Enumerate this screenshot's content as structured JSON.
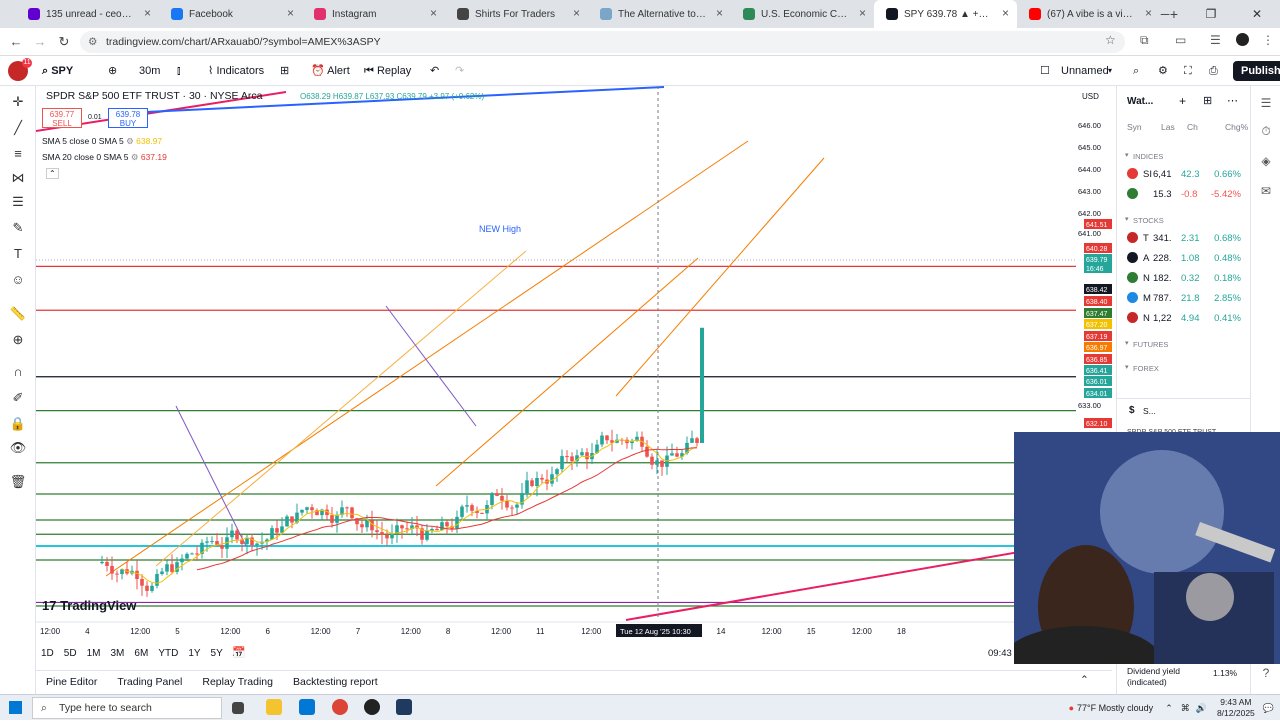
{
  "browser": {
    "tabs": [
      {
        "label": "135 unread - ceo4ams@y",
        "color": "#6001d2"
      },
      {
        "label": "Facebook",
        "color": "#1877f2"
      },
      {
        "label": "Instagram",
        "color": "#e1306c"
      },
      {
        "label": "Shirts For Traders",
        "color": "#444444"
      },
      {
        "label": "The Alternative to IVF - D",
        "color": "#7aa7c7"
      },
      {
        "label": "U.S. Economic Calendar -",
        "color": "#2e8b57"
      },
      {
        "label": "SPY 639.78 ▲ +0.61% Uni",
        "color": "#131722",
        "active": true
      },
      {
        "label": "(67) A vibe is a vibe r",
        "color": "#ff0000"
      }
    ],
    "url": "tradingview.com/chart/ARxauab0/?symbol=AMEX%3ASPY"
  },
  "toolbar": {
    "symbol": "SPY",
    "interval": "30m",
    "indicators": "Indicators",
    "alert": "Alert",
    "replay": "Replay",
    "layout": "Unnamed",
    "publish": "Publish"
  },
  "chart": {
    "title": "SPDR S&P 500 ETF TRUST · 30 · NYSE Arca",
    "ohlc": "O638.29 H639.87 L637.93 C639.79 +3.97 (+0.62%)",
    "sell_price": "639.77",
    "sell_label": "SELL",
    "spread": "0.01",
    "buy_price": "639.78",
    "buy_label": "BUY",
    "sma5_label": "SMA 5 close 0 SMA 5",
    "sma5_value": "638.97",
    "sma20_label": "SMA 20 close 0 SMA 5",
    "sma20_value": "637.19",
    "annotation": "NEW High",
    "currency": "USD",
    "price_ticks": [
      "646.00",
      "645.00",
      "644.00",
      "643.00",
      "642.00",
      "641.00",
      "633.00"
    ],
    "price_tags": [
      {
        "label": "641.51",
        "color": "#e53935"
      },
      {
        "label": "640.28",
        "color": "#e53935"
      },
      {
        "label": "639.79",
        "color": "#26a69a"
      },
      {
        "label": "16:46",
        "color": "#26a69a"
      },
      {
        "label": "638.42",
        "color": "#131722"
      },
      {
        "label": "638.40",
        "color": "#e53935"
      },
      {
        "label": "637.47",
        "color": "#2e7d32"
      },
      {
        "label": "637.20",
        "color": "#f2c200"
      },
      {
        "label": "637.19",
        "color": "#e53935"
      },
      {
        "label": "636.97",
        "color": "#f57c00"
      },
      {
        "label": "636.85",
        "color": "#e53935"
      },
      {
        "label": "636.41",
        "color": "#26a69a"
      },
      {
        "label": "636.01",
        "color": "#26a69a"
      },
      {
        "label": "634.01",
        "color": "#26a69a"
      },
      {
        "label": "632.10",
        "color": "#e53935"
      }
    ],
    "time_ticks": [
      "12:00",
      "4",
      "12:00",
      "5",
      "12:00",
      "6",
      "12:00",
      "7",
      "12:00",
      "8",
      "12:00",
      "11",
      "12:00",
      "13",
      "12:00",
      "14",
      "12:00",
      "15",
      "12:00",
      "18"
    ],
    "crosshair_time": "Tue 12 Aug '25   10:30",
    "clock": "09:43",
    "watermark": "TradingView",
    "ranges": [
      "1D",
      "5D",
      "1M",
      "3M",
      "6M",
      "YTD",
      "1Y",
      "5Y",
      "All"
    ],
    "colors": {
      "up": "#26a69a",
      "down": "#ef5350",
      "sma5": "#f2c200",
      "sma20": "#e53935",
      "channel": "#f57c00"
    }
  },
  "chart_data": {
    "type": "candlestick",
    "series": [
      {
        "name": "SMA 5 close 0 SMA 5"
      },
      {
        "name": "SMA 20 close 0 SMA 5"
      }
    ],
    "ylim": [
      632,
      646
    ],
    "horizontal_levels": [
      641.51,
      640.28,
      638.42,
      637.47,
      636.01,
      634.01,
      632.1
    ],
    "last_close": 639.79
  },
  "bottom_panels": [
    "Pine Editor",
    "Trading Panel",
    "Replay Trading",
    "Backtesting report"
  ],
  "watchlist": {
    "title": "Wat...",
    "cols": [
      "Syn",
      "Las",
      "Ch",
      "Chg%"
    ],
    "sections": [
      "INDICES",
      "STOCKS",
      "FUTURES",
      "FOREX"
    ],
    "indices": [
      {
        "sym": "SI",
        "last": "6,41",
        "chg": "42.3",
        "pct": "0.66%",
        "up": true,
        "color": "#e53935"
      },
      {
        "sym": "",
        "last": "15.3",
        "chg": "-0.8",
        "pct": "-5.42%",
        "up": false,
        "color": "#2e7d32"
      }
    ],
    "stocks": [
      {
        "sym": "T",
        "last": "341.",
        "chg": "2.31",
        "pct": "0.68%",
        "color": "#c62828"
      },
      {
        "sym": "A",
        "last": "228.",
        "chg": "1.08",
        "pct": "0.48%",
        "color": "#131722"
      },
      {
        "sym": "N",
        "last": "182.",
        "chg": "0.32",
        "pct": "0.18%",
        "color": "#2e7d32"
      },
      {
        "sym": "M",
        "last": "787.",
        "chg": "21.8",
        "pct": "2.85%",
        "color": "#1e88e5"
      },
      {
        "sym": "N",
        "last": "1,22",
        "chg": "4.94",
        "pct": "0.41%",
        "color": "#c62828"
      }
    ],
    "detail_symbol": "S...",
    "detail_name": "SPDR S&P 500 ETF TRUST",
    "dividend_label": "Dividend yield (indicated)",
    "dividend_value": "1.13%"
  },
  "taskbar": {
    "search_placeholder": "Type here to search",
    "weather": "77°F  Mostly cloudy",
    "time": "9:43 AM",
    "date": "8/12/2025"
  }
}
